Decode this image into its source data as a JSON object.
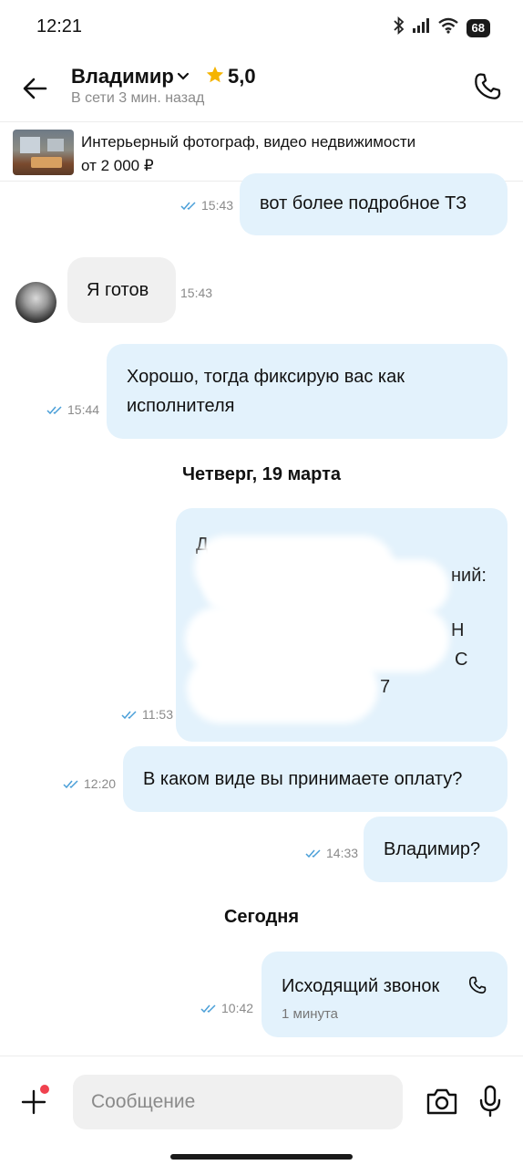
{
  "status_bar": {
    "time": "12:21",
    "battery": "68"
  },
  "header": {
    "contact_name": "Владимир",
    "rating": "5,0",
    "status": "В сети 3 мин. назад"
  },
  "listing": {
    "title": "Интерьерный фотограф, видео недвижимости",
    "price": "от 2 000 ₽"
  },
  "messages": [
    {
      "direction": "out",
      "text": "вот более подробное ТЗ",
      "time": "15:43"
    },
    {
      "direction": "in",
      "text": "Я готов",
      "time": "15:43"
    },
    {
      "direction": "out",
      "text": "Хорошо, тогда фиксирую вас как исполнителя",
      "line1": "Хорошо, тогда фиксирую вас как",
      "line2": "исполнителя",
      "time": "15:44"
    },
    {
      "direction": "out",
      "text": "[redacted]",
      "time": "11:53",
      "visible_fragments": [
        "Д",
        "ний:",
        "Н",
        "С",
        "7"
      ]
    },
    {
      "direction": "out",
      "text": "В каком виде вы принимаете оплату?",
      "time": "12:20"
    },
    {
      "direction": "out",
      "text": "Владимир?",
      "time": "14:33"
    },
    {
      "direction": "out",
      "type": "call",
      "text": "Исходящий звонок",
      "duration": "1 минута",
      "time": "10:42"
    }
  ],
  "day_separators": [
    "Четверг, 19 марта",
    "Сегодня"
  ],
  "composer": {
    "placeholder": "Сообщение"
  },
  "colors": {
    "outgoing_bubble": "#e3f2fc",
    "incoming_bubble": "#f0f0f0",
    "read_ticks": "#4a9fd8",
    "star": "#f5b400",
    "notification_dot": "#f0414e"
  }
}
